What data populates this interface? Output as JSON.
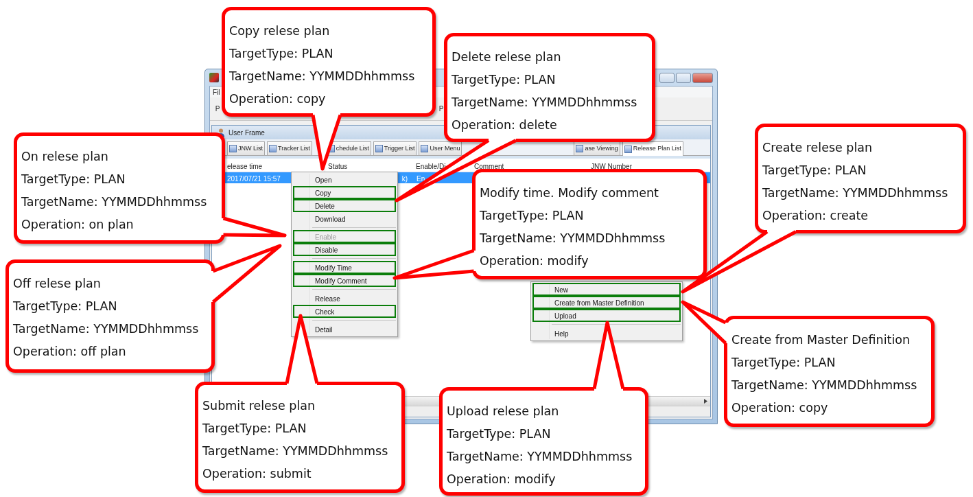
{
  "window": {
    "menu": [
      "Fil"
    ],
    "toolbar": [
      "P",
      "P"
    ],
    "frame_title": "User Frame",
    "tabs": [
      {
        "label": "JNW List",
        "selected": false
      },
      {
        "label": "Tracker List",
        "selected": false
      },
      {
        "label": "chedule List",
        "selected": false
      },
      {
        "label": "Trigger List",
        "selected": false
      },
      {
        "label": "User Menu",
        "selected": false
      },
      {
        "label": "ase Viewing",
        "selected": false
      },
      {
        "label": "Release Plan List",
        "selected": true
      }
    ],
    "columns": [
      "elease time",
      "Status",
      "Enable/Di",
      "Comment",
      "JNW Number"
    ],
    "rows": [
      {
        "selected": true,
        "cells": [
          "2017/07/21 15:57",
          "k)",
          "En"
        ]
      }
    ]
  },
  "context_menu": {
    "groups": [
      [
        {
          "label": "Open",
          "highlighted": false,
          "disabled": false
        },
        {
          "label": "Copy",
          "highlighted": true,
          "disabled": false
        },
        {
          "label": "Delete",
          "highlighted": true,
          "disabled": false
        },
        {
          "label": "Download",
          "highlighted": false,
          "disabled": false
        }
      ],
      [
        {
          "label": "Enable",
          "highlighted": true,
          "disabled": true
        },
        {
          "label": "Disable",
          "highlighted": true,
          "disabled": false
        }
      ],
      [
        {
          "label": "Modify Time",
          "highlighted": true,
          "disabled": false
        },
        {
          "label": "Modify Comment",
          "highlighted": true,
          "disabled": false
        }
      ],
      [
        {
          "label": "Release",
          "highlighted": false,
          "disabled": false
        },
        {
          "label": "Check",
          "highlighted": true,
          "disabled": false
        }
      ],
      [
        {
          "label": "Detail",
          "highlighted": false,
          "disabled": false
        }
      ]
    ]
  },
  "new_menu": {
    "groups": [
      [
        {
          "label": "New",
          "highlighted": true,
          "disabled": false
        },
        {
          "label": "Create from Master Definition",
          "highlighted": true,
          "disabled": false
        },
        {
          "label": "Upload",
          "highlighted": true,
          "disabled": false
        }
      ],
      [
        {
          "label": "Help",
          "highlighted": false,
          "disabled": false
        }
      ]
    ]
  },
  "callouts": [
    {
      "title": "Copy relese plan",
      "lines": [
        "TargetType: PLAN",
        "TargetName: YYMMDDhhmmss",
        "Operation: copy"
      ]
    },
    {
      "title": "Delete relese plan",
      "lines": [
        "TargetType: PLAN",
        "TargetName: YYMMDDhhmmss",
        "Operation: delete"
      ]
    },
    {
      "title": "On relese plan",
      "lines": [
        "TargetType: PLAN",
        "TargetName: YYMMDDhhmmss",
        "Operation: on plan"
      ]
    },
    {
      "title": "Off relese plan",
      "lines": [
        "TargetType: PLAN",
        "TargetName: YYMMDDhhmmss",
        "Operation: off plan"
      ]
    },
    {
      "title": "Modify time. Modify comment",
      "lines": [
        "TargetType: PLAN",
        "TargetName: YYMMDDhhmmss",
        "Operation: modify"
      ]
    },
    {
      "title": "Create relese plan",
      "lines": [
        "TargetType: PLAN",
        "TargetName: YYMMDDhhmmss",
        "Operation: create"
      ]
    },
    {
      "title": "Create from Master Definition",
      "lines": [
        "TargetType: PLAN",
        "TargetName: YYMMDDhhmmss",
        "Operation: copy"
      ]
    },
    {
      "title": "Submit relese plan",
      "lines": [
        "TargetType: PLAN",
        "TargetName: YYMMDDhhmmss",
        "Operation: submit"
      ]
    },
    {
      "title": "Upload relese plan",
      "lines": [
        "TargetType: PLAN",
        "TargetName: YYMMDDhhmmss",
        "Operation: modify"
      ]
    }
  ]
}
